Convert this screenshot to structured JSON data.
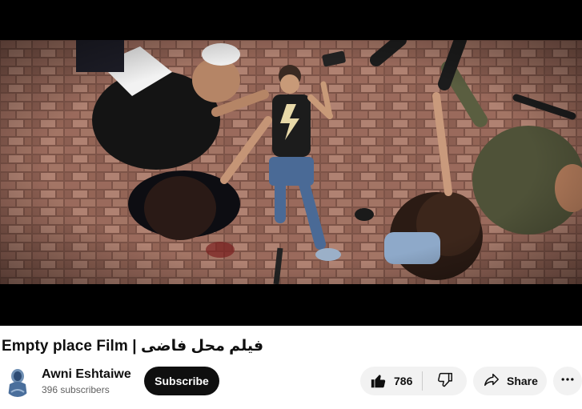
{
  "video": {
    "title": "Empty place Film | فيلم محل فاضى"
  },
  "channel": {
    "name": "Awni Eshtaiwe",
    "subscribers": "396 subscribers",
    "subscribe_label": "Subscribe",
    "avatar_icon": "avatar-silhouette-icon"
  },
  "actions": {
    "like_count": "786",
    "like_icon": "thumbs-up-icon",
    "dislike_icon": "thumbs-down-icon",
    "share_label": "Share",
    "share_icon": "share-arrow-icon",
    "more_icon": "more-horizontal-icon"
  },
  "colors": {
    "subscribe_bg": "#0f0f0f",
    "pill_bg": "#f2f2f2",
    "subtext": "#606060",
    "brick": "#8a5a4e"
  }
}
